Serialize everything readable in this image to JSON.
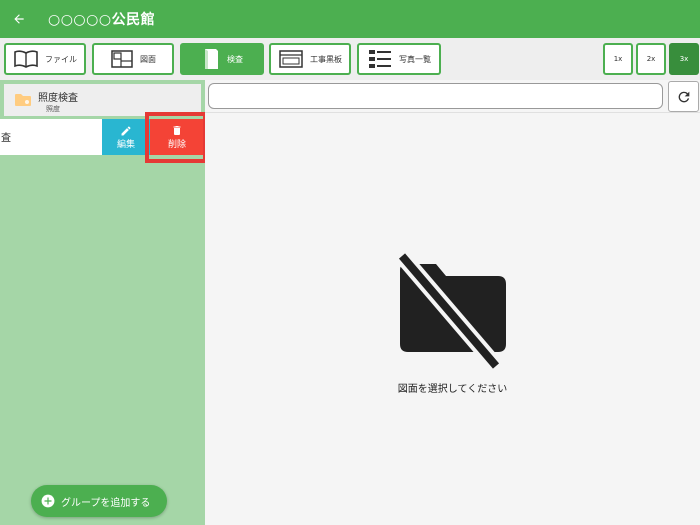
{
  "appbar": {
    "title": "○○○○○公民館"
  },
  "toolbar": {
    "buttons": [
      {
        "label": "ファイル",
        "icon": "book-icon"
      },
      {
        "label": "図面",
        "icon": "floorplan-icon"
      },
      {
        "label": "検査",
        "icon": "notebook-icon"
      },
      {
        "label": "工事黒板",
        "icon": "board-icon"
      },
      {
        "label": "写真一覧",
        "icon": "photo-list-icon"
      }
    ],
    "zoom": [
      "1x",
      "2x",
      "3x"
    ],
    "active_zoom": "3x"
  },
  "sidebar": {
    "folder": {
      "title": "照度検査",
      "subtitle": "照度"
    },
    "row_label": "査",
    "edit_label": "編集",
    "delete_label": "削除",
    "add_group_label": "グループを追加する"
  },
  "main": {
    "search_value": "",
    "empty_message": "図面を選択してください"
  },
  "colors": {
    "primary": "#4caf50",
    "edit": "#29b6d1",
    "delete": "#f44336",
    "sidebar": "#a5d6a7"
  }
}
